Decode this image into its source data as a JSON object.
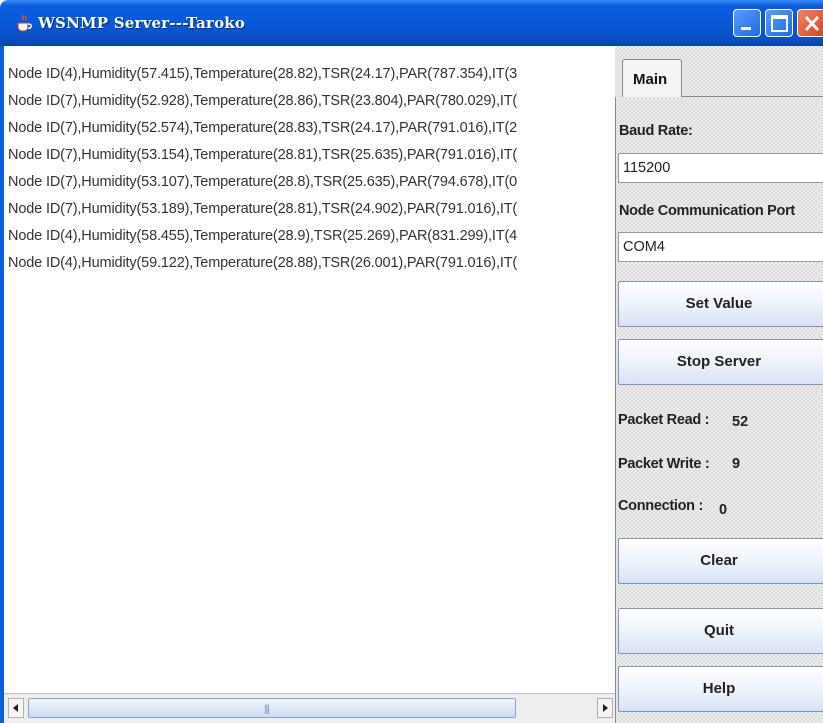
{
  "window": {
    "title": "WSNMP Server---Taroko"
  },
  "log": {
    "lines": [
      "Node ID(4),Humidity(57.415),Temperature(28.82),TSR(24.17),PAR(787.354),IT(3",
      "Node ID(7),Humidity(52.928),Temperature(28.86),TSR(23.804),PAR(780.029),IT(",
      "Node ID(7),Humidity(52.574),Temperature(28.83),TSR(24.17),PAR(791.016),IT(2",
      "Node ID(7),Humidity(53.154),Temperature(28.81),TSR(25.635),PAR(791.016),IT(",
      "Node ID(7),Humidity(53.107),Temperature(28.8),TSR(25.635),PAR(794.678),IT(0",
      "Node ID(7),Humidity(53.189),Temperature(28.81),TSR(24.902),PAR(791.016),IT(",
      "Node ID(4),Humidity(58.455),Temperature(28.9),TSR(25.269),PAR(831.299),IT(4",
      "Node ID(4),Humidity(59.122),Temperature(28.88),TSR(26.001),PAR(791.016),IT("
    ]
  },
  "panel": {
    "tab_label": "Main",
    "baud_label": "Baud Rate:",
    "baud_value": "115200",
    "port_label": "Node Communication Port",
    "port_value": "COM4",
    "set_value_label": "Set Value",
    "stop_server_label": "Stop Server",
    "packet_read_label": "Packet Read :",
    "packet_read_value": "52",
    "packet_write_label": "Packet Write :",
    "packet_write_value": "9",
    "connection_label": "Connection :",
    "connection_value": "0",
    "clear_label": "Clear",
    "quit_label": "Quit",
    "help_label": "Help"
  },
  "icons": {
    "app": "java-cup-icon",
    "minimize": "minimize-icon",
    "maximize": "maximize-icon",
    "close": "close-icon",
    "scroll_left": "arrow-left-icon",
    "scroll_right": "arrow-right-icon"
  },
  "colors": {
    "titlebar": "#0858d6",
    "close_button": "#d9431b",
    "button_border": "#7d95bd"
  }
}
